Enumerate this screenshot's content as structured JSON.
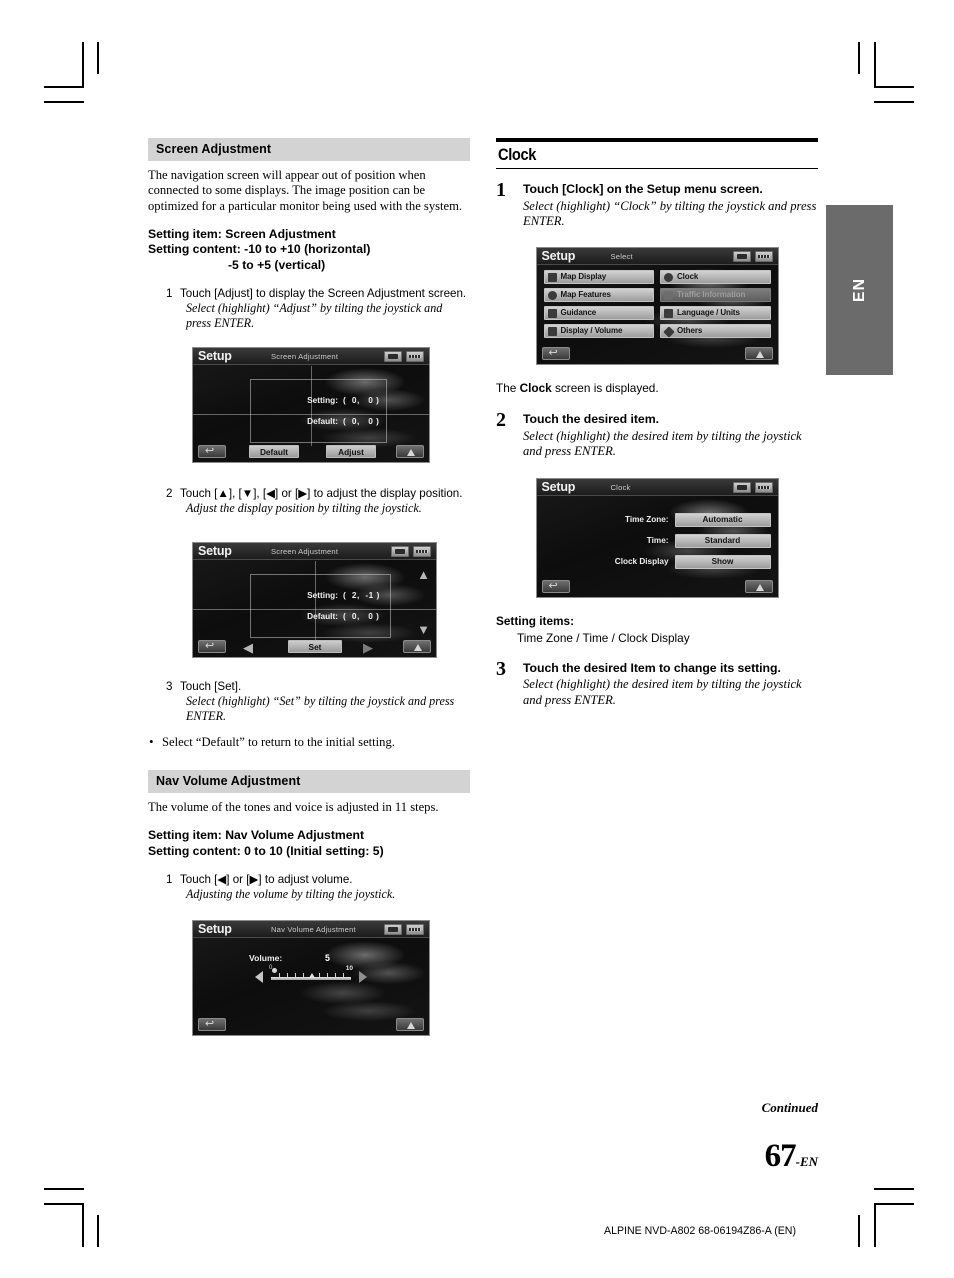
{
  "document": {
    "page_number": "67",
    "page_suffix": "-EN",
    "continued": "Continued",
    "footer_code": "ALPINE NVD-A802 68-06194Z86-A (EN)",
    "side_tab": "EN"
  },
  "left_column": {
    "screen_adjustment": {
      "heading": "Screen Adjustment",
      "intro": "The navigation screen will appear out of position when connected to some displays. The image position can be optimized for a particular monitor being used with the system.",
      "setting_item_label": "Setting item: Screen Adjustment",
      "setting_content_label": "Setting content: -10 to +10 (horizontal)",
      "setting_content_label2": "-5 to +5 (vertical)",
      "step1": {
        "num": "1",
        "text": "Touch [Adjust] to display the Screen Adjustment screen.",
        "italic": "Select (highlight) “Adjust” by tilting the joystick and press ENTER."
      },
      "step2": {
        "num": "2",
        "text": "Touch [▲], [▼], [◀] or [▶] to adjust the display position.",
        "italic": "Adjust the display position by tilting the joystick."
      },
      "step3": {
        "num": "3",
        "text": "Touch [Set].",
        "italic": "Select (highlight) “Set” by tilting the joystick and press ENTER."
      },
      "bullet": "Select “Default” to return to the initial setting."
    },
    "nav_volume": {
      "heading": "Nav Volume Adjustment",
      "intro": "The volume of the tones and voice is adjusted in 11 steps.",
      "setting_item_label": "Setting item: Nav Volume Adjustment",
      "setting_content_label": "Setting content: 0 to 10 (Initial setting: 5)",
      "step1": {
        "num": "1",
        "text": "Touch [◀] or [▶] to adjust volume.",
        "italic": "Adjusting the volume by tilting the joystick."
      }
    }
  },
  "right_column": {
    "clock": {
      "heading": "Clock",
      "step1": {
        "num": "1",
        "title": "Touch [Clock] on the Setup menu screen.",
        "italic": "Select (highlight) “Clock” by tilting the joystick and press ENTER."
      },
      "after_step1": "The Clock screen is displayed.",
      "after_step1_bold": "Clock",
      "step2": {
        "num": "2",
        "title": "Touch the desired item.",
        "italic": "Select (highlight) the desired item by tilting the joystick and press ENTER."
      },
      "setting_items_label": "Setting items:",
      "setting_items_value": "Time Zone / Time / Clock Display",
      "step3": {
        "num": "3",
        "title": "Touch the desired Item to change its setting.",
        "italic": "Select (highlight) the desired item by tilting the joystick and press ENTER."
      }
    }
  },
  "device_screens": {
    "screen_adjust_initial": {
      "brand": "Setup",
      "subtitle": "Screen Adjustment",
      "rows": [
        {
          "label": "Setting:",
          "value": "(  0,   0 )"
        },
        {
          "label": "Default:",
          "value": "(  0,   0 )"
        }
      ],
      "buttons": {
        "default": "Default",
        "adjust": "Adjust"
      }
    },
    "screen_adjust_adjusting": {
      "brand": "Setup",
      "subtitle": "Screen Adjustment",
      "rows": [
        {
          "label": "Setting:",
          "value": "(  2,  -1 )"
        },
        {
          "label": "Default:",
          "value": "(  0,   0 )"
        }
      ],
      "buttons": {
        "set": "Set"
      },
      "arrows": {
        "up": "▲",
        "down": "▼",
        "left": "◀",
        "right": "▶"
      }
    },
    "nav_volume_screen": {
      "brand": "Setup",
      "subtitle": "Nav Volume Adjustment",
      "volume_label": "Volume:",
      "volume_value": "5",
      "scale_min": "0",
      "scale_max": "10"
    },
    "setup_select": {
      "brand": "Setup",
      "subtitle": "Select",
      "items": [
        {
          "label": "Map Display",
          "icon": "map-display-icon",
          "disabled": false
        },
        {
          "label": "Clock",
          "icon": "clock-icon",
          "disabled": false
        },
        {
          "label": "Map Features",
          "icon": "map-features-icon",
          "disabled": false
        },
        {
          "label": "Traffic Information",
          "icon": "traffic-icon",
          "disabled": true
        },
        {
          "label": "Guidance",
          "icon": "guidance-icon",
          "disabled": false
        },
        {
          "label": "Language / Units",
          "icon": "abc-icon",
          "disabled": false
        },
        {
          "label": "Display / Volume",
          "icon": "display-volume-icon",
          "disabled": false
        },
        {
          "label": "Others",
          "icon": "others-icon",
          "disabled": false
        }
      ]
    },
    "clock_screen": {
      "brand": "Setup",
      "subtitle": "Clock",
      "rows": [
        {
          "label": "Time Zone:",
          "value": "Automatic"
        },
        {
          "label": "Time:",
          "value": "Standard"
        },
        {
          "label": "Clock Display",
          "value": "Show"
        }
      ]
    }
  }
}
